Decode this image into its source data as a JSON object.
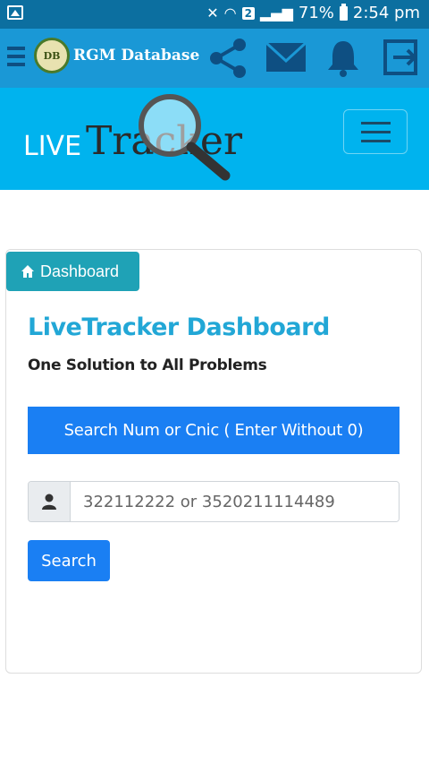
{
  "status_bar": {
    "battery": "71%",
    "time": "2:54 pm",
    "sim_slot": "2"
  },
  "app_header": {
    "logo_text": "DB",
    "title": "RGM Database"
  },
  "brand": {
    "part1": "LIVE",
    "part2": "Tracker"
  },
  "card": {
    "tab_label": "Dashboard",
    "heading": "LiveTracker Dashboard",
    "subheading": "One Solution to All Problems",
    "banner": "Search Num or Cnic ( Enter Without 0)",
    "input_placeholder": "322112222 or 3520211114489",
    "button_label": "Search"
  },
  "colors": {
    "status_bar": "#0c6fa0",
    "app_header": "#1a98d6",
    "brand_bar": "#00b3ee",
    "tab": "#1fa2b6",
    "primary": "#1a7ff3",
    "heading": "#22a7d6"
  }
}
